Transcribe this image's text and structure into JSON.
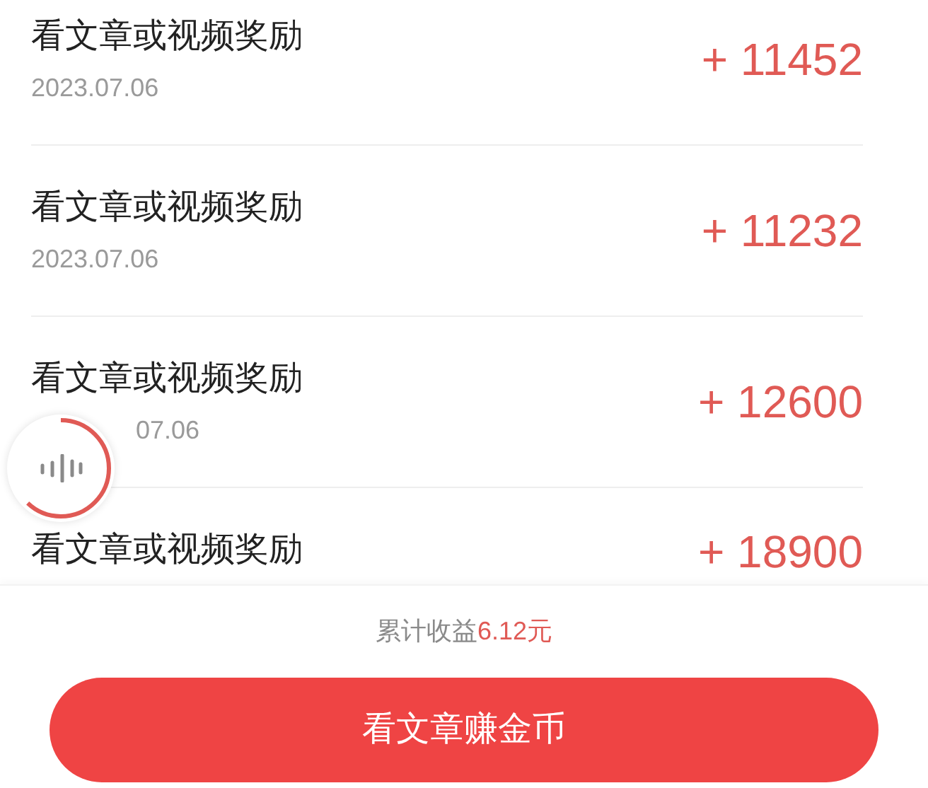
{
  "records": [
    {
      "title": "看文章或视频奖励",
      "date": "2023.07.06",
      "amount": "+ 11452"
    },
    {
      "title": "看文章或视频奖励",
      "date": "2023.07.06",
      "amount": "+ 11232"
    },
    {
      "title": "看文章或视频奖励",
      "date": "07.06",
      "amount": "+ 12600"
    },
    {
      "title": "看文章或视频奖励",
      "amount": "+ 18900"
    }
  ],
  "floating_widget": {
    "level": 0.62
  },
  "summary": {
    "label": "累计收益",
    "value": "6.12元"
  },
  "action_button": "看文章赚金币"
}
